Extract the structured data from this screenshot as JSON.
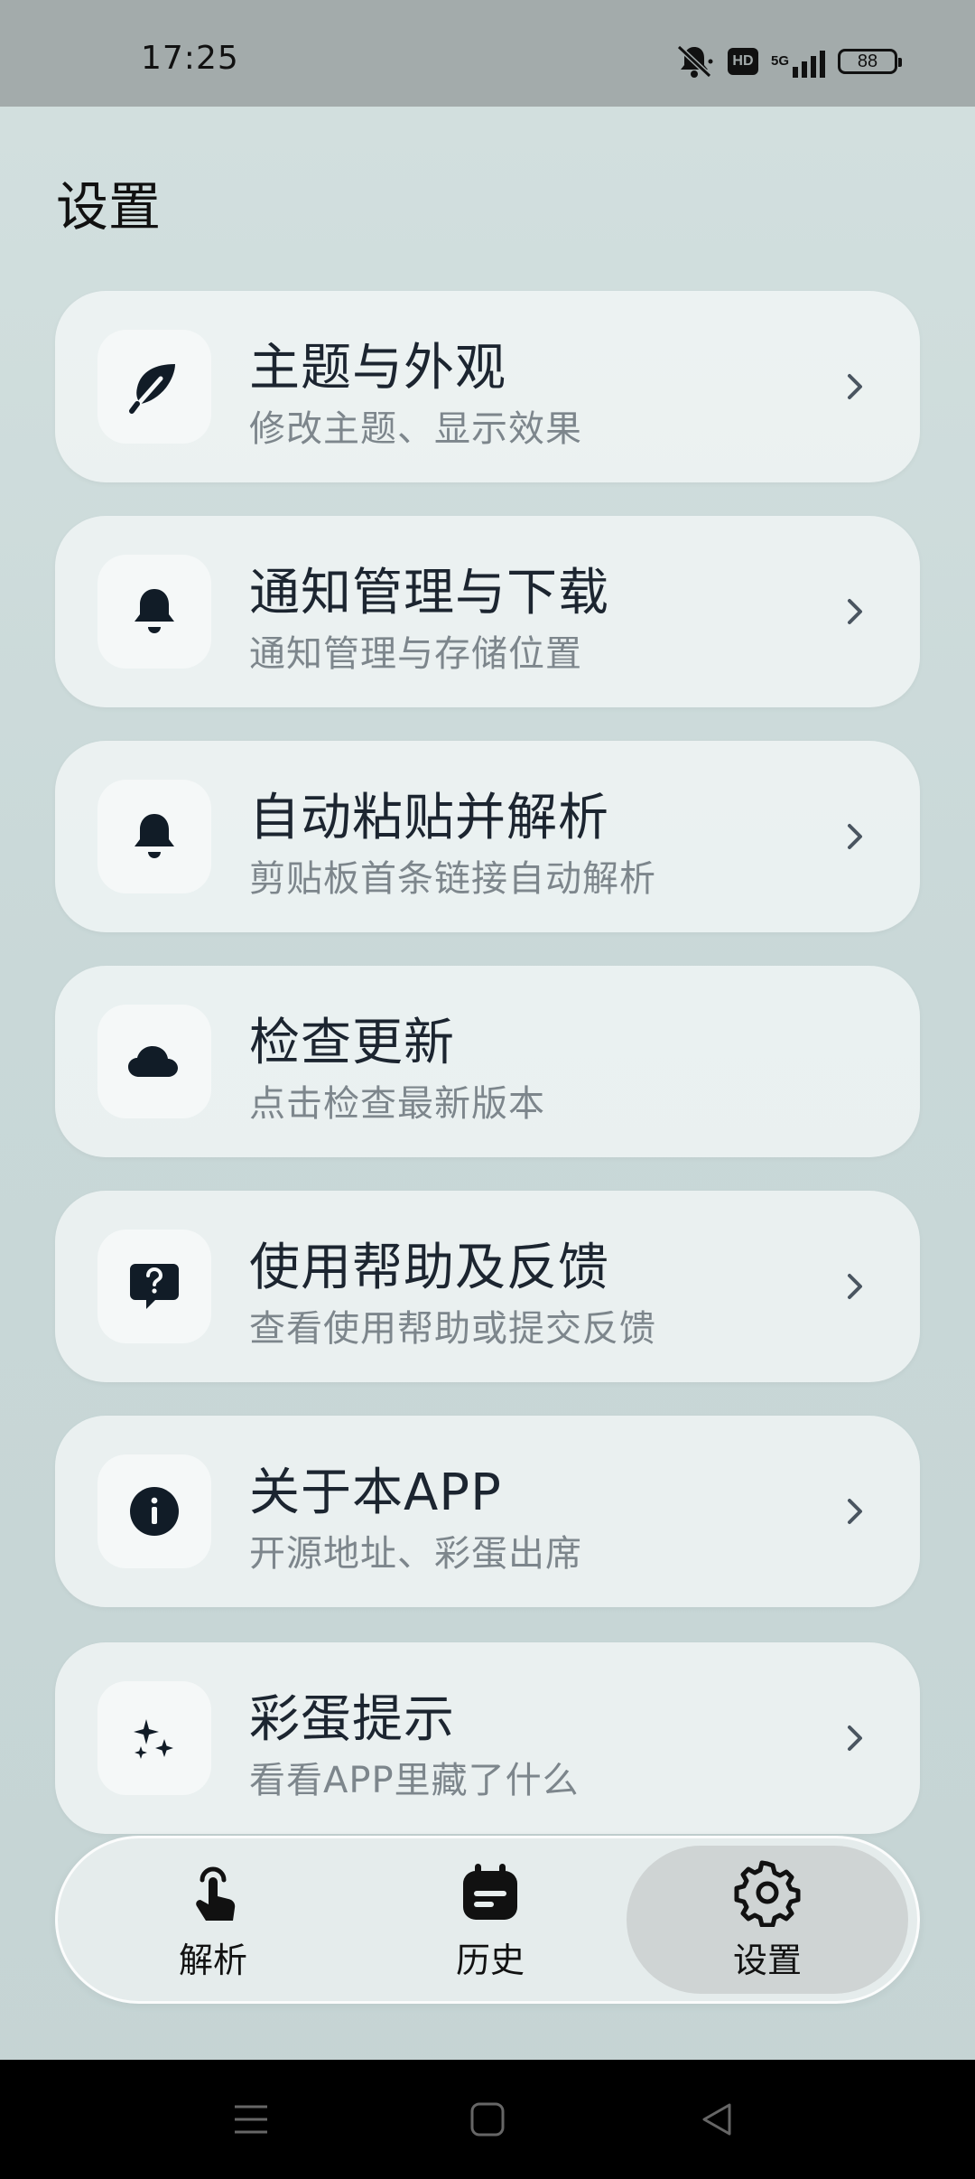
{
  "status_bar": {
    "time": "17:25",
    "network": "5G",
    "hd": "HD",
    "battery": "88",
    "icons": [
      "bell-off-icon",
      "hd-icon",
      "signal-5g-icon",
      "battery-icon"
    ]
  },
  "page": {
    "title": "设置"
  },
  "settings": [
    {
      "icon": "leaf-icon",
      "title": "主题与外观",
      "subtitle": "修改主题、显示效果"
    },
    {
      "icon": "bell-icon",
      "title": "通知管理与下载",
      "subtitle": "通知管理与存储位置"
    },
    {
      "icon": "bell-icon",
      "title": "自动粘贴并解析",
      "subtitle": "剪贴板首条链接自动解析"
    },
    {
      "icon": "cloud-icon",
      "title": "检查更新",
      "subtitle": "点击检查最新版本"
    },
    {
      "icon": "help-chat-icon",
      "title": "使用帮助及反馈",
      "subtitle": "查看使用帮助或提交反馈"
    },
    {
      "icon": "info-icon",
      "title": "关于本APP",
      "subtitle": "开源地址、彩蛋出席"
    },
    {
      "icon": "sparkles-icon",
      "title": "彩蛋提示",
      "subtitle": "看看APP里藏了什么"
    }
  ],
  "bottom_nav": [
    {
      "icon": "tap-icon",
      "label": "解析",
      "active": false
    },
    {
      "icon": "history-icon",
      "label": "历史",
      "active": false
    },
    {
      "icon": "gear-icon",
      "label": "设置",
      "active": true
    }
  ],
  "system_nav": [
    "menu-icon",
    "home-icon",
    "back-icon"
  ],
  "colors": {
    "background": "#cdd9d9",
    "card": "#f3f7f7",
    "title_text": "#1c2530",
    "subtitle_text": "#7d868c",
    "active_tab": "#cfd4d4"
  }
}
